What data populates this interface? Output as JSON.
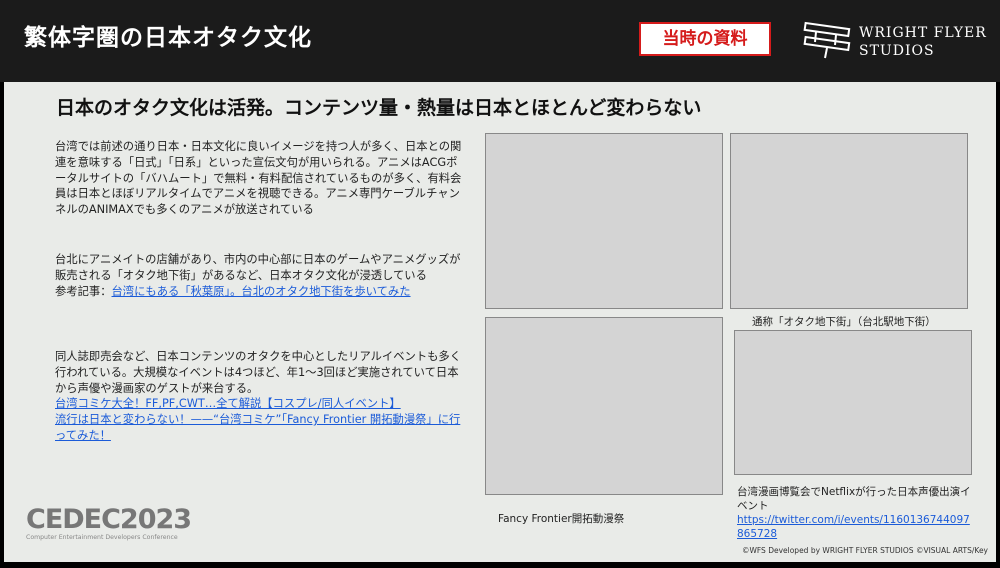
{
  "header": {
    "title": "繁体字圏の日本オタク文化",
    "badge": "当時の資料",
    "logo_line1": "WRIGHT FLYER",
    "logo_line2": "STUDIOS"
  },
  "slide": {
    "headline": "日本のオタク文化は活発。コンテンツ量・熱量は日本とほとんど変わらない",
    "para1": "台湾では前述の通り日本・日本文化に良いイメージを持つ人が多く、日本との関連を意味する「日式」「日系」といった宣伝文句が用いられる。アニメはACGポータルサイトの「バハムート」で無料・有料配信されているものが多く、有料会員は日本とほぼリアルタイムでアニメを視聴できる。アニメ専門ケーブルチャンネルのANIMAXでも多くのアニメが放送されている",
    "para2": "台北にアニメイトの店舗があり、市内の中心部に日本のゲームやアニメグッズが販売される「オタク地下街」があるなど、日本オタク文化が浸透している",
    "ref_label": "参考記事：",
    "ref_link1": "台湾にもある「秋葉原」。台北のオタク地下街を歩いてみた",
    "para3": "同人誌即売会など、日本コンテンツのオタクを中心としたリアルイベントも多く行われている。大規模なイベントは4つほど、年1〜3回ほど実施されていて日本から声優や漫画家のゲストが来台する。",
    "link2": "台湾コミケ大全！FF,PF,CWT…全て解説【コスプレ/同人イベント】",
    "link3": "流行は日本と変わらない！——“台湾コミケ”「Fancy Frontier 開拓動漫祭」に行ってみた！",
    "caption_underground": "通称「オタク地下街」（台北駅地下街）",
    "caption_ff": "Fancy Frontier開拓動漫祭",
    "caption_netflix": "台湾漫画博覧会でNetflixが行った日本声優出演イベント",
    "netflix_url": "https://twitter.com/i/events/1160136744097865728",
    "cedec_logo": "CEDEC2023",
    "cedec_sub": "Computer Entertainment Developers Conference",
    "copyright": "©WFS Developed by WRIGHT FLYER STUDIOS ©VISUAL ARTS/Key"
  }
}
